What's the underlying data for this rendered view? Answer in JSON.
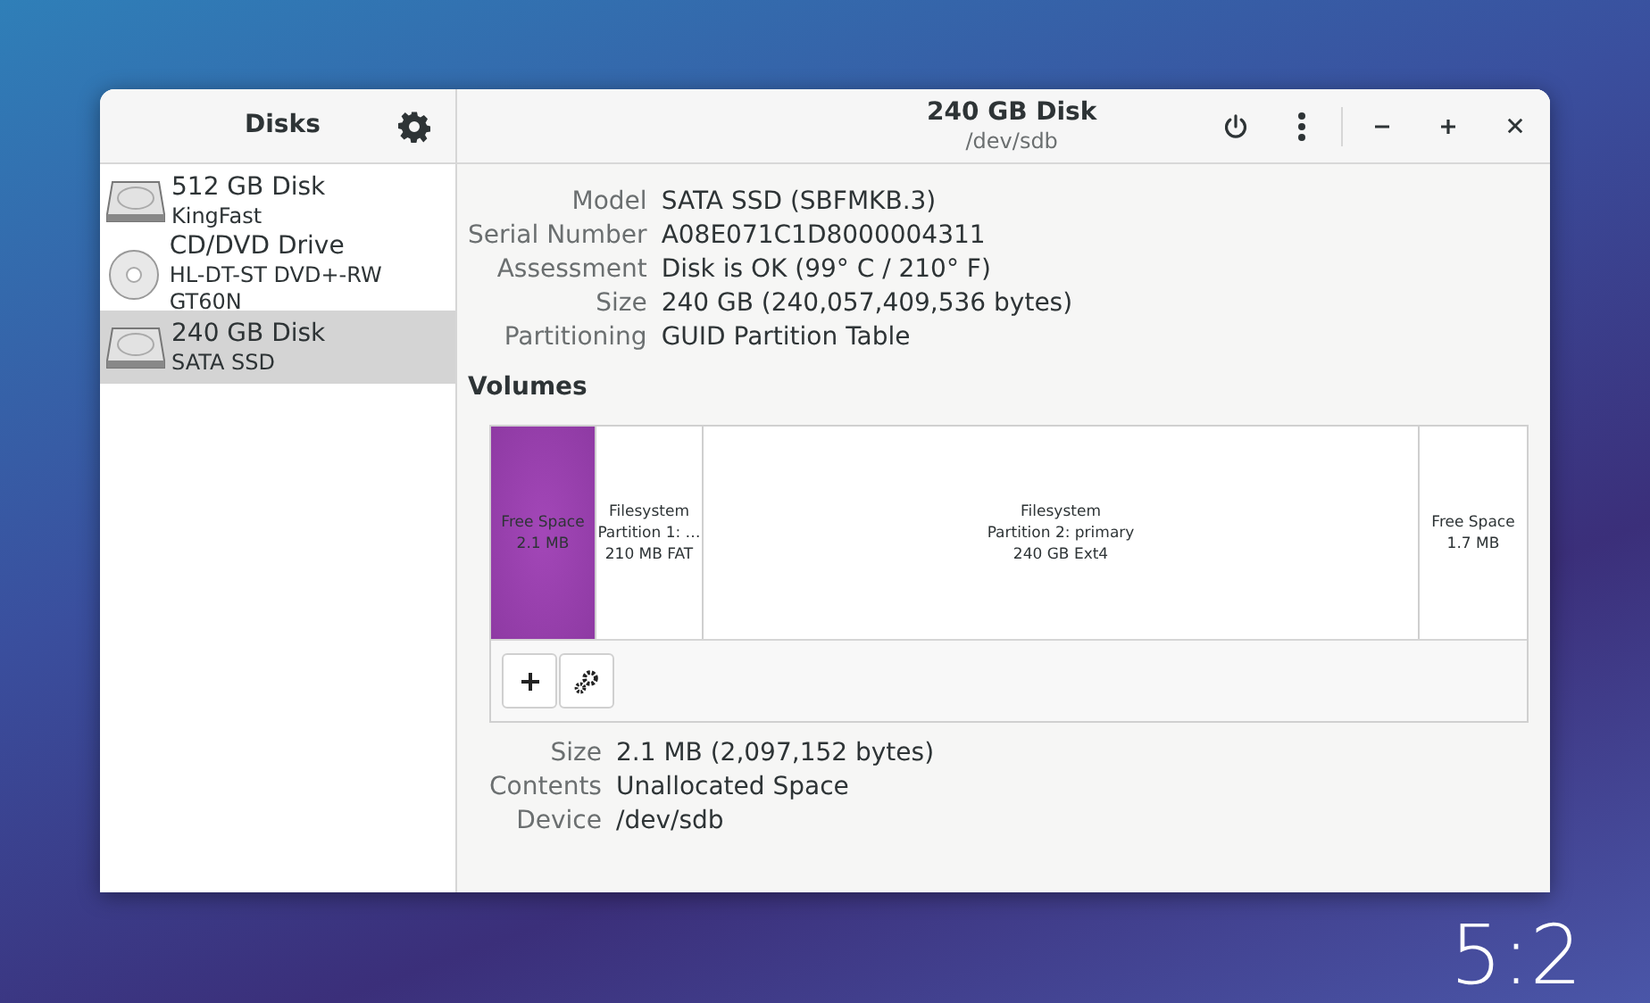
{
  "window": {
    "sidebar_title": "Disks",
    "title": "240 GB Disk",
    "subtitle": "/dev/sdb"
  },
  "drives": [
    {
      "kind": "disk",
      "name": "512 GB Disk",
      "detail": "KingFast",
      "selected": false
    },
    {
      "kind": "optical",
      "name": "CD/DVD Drive",
      "detail": "HL-DT-ST DVD+-RW GT60N",
      "selected": false
    },
    {
      "kind": "disk",
      "name": "240 GB Disk",
      "detail": "SATA SSD",
      "selected": true
    }
  ],
  "disk_info": [
    {
      "label": "Model",
      "value": "SATA SSD (SBFMKB.3)"
    },
    {
      "label": "Serial Number",
      "value": "A08E071C1D8000004311"
    },
    {
      "label": "Assessment",
      "value": "Disk is OK (99° C / 210° F)"
    },
    {
      "label": "Size",
      "value": "240 GB (240,057,409,536 bytes)"
    },
    {
      "label": "Partitioning",
      "value": "GUID Partition Table"
    }
  ],
  "volumes_heading": "Volumes",
  "volumes": [
    {
      "lines": [
        "Free Space",
        "2.1 MB"
      ],
      "selected": true
    },
    {
      "lines": [
        "Filesystem",
        "Partition 1: …",
        "210 MB FAT"
      ],
      "selected": false
    },
    {
      "lines": [
        "Filesystem",
        "Partition 2: primary",
        "240 GB Ext4"
      ],
      "selected": false
    },
    {
      "lines": [
        "Free Space",
        "1.7 MB"
      ],
      "selected": false
    }
  ],
  "volume_info": [
    {
      "label": "Size",
      "value": "2.1 MB (2,097,152 bytes)"
    },
    {
      "label": "Contents",
      "value": "Unallocated Space"
    },
    {
      "label": "Device",
      "value": "/dev/sdb"
    }
  ],
  "clock": "5:2"
}
